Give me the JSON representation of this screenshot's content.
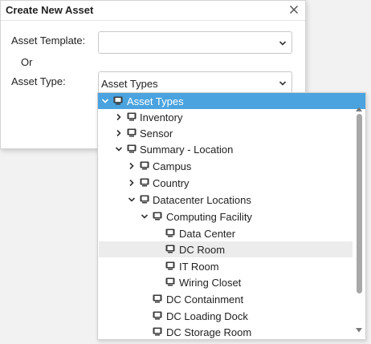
{
  "dialog": {
    "title": "Create New Asset",
    "asset_template_label": "Asset Template:",
    "asset_template_value": "",
    "or_label": "Or",
    "asset_type_label": "Asset Type:",
    "asset_type_value": "Asset Types"
  },
  "tree": {
    "items": [
      {
        "label": "Asset Types",
        "icon": "asset-node-icon",
        "toggle": "expanded"
      },
      {
        "label": "Inventory",
        "icon": "asset-node-icon",
        "toggle": "collapsed"
      },
      {
        "label": "Sensor",
        "icon": "asset-node-icon",
        "toggle": "collapsed"
      },
      {
        "label": "Summary - Location",
        "icon": "asset-node-icon",
        "toggle": "expanded"
      },
      {
        "label": "Campus",
        "icon": "asset-node-icon",
        "toggle": "collapsed"
      },
      {
        "label": "Country",
        "icon": "asset-node-icon",
        "toggle": "collapsed"
      },
      {
        "label": "Datacenter Locations",
        "icon": "asset-node-icon",
        "toggle": "expanded"
      },
      {
        "label": "Computing Facility",
        "icon": "asset-node-icon",
        "toggle": "expanded"
      },
      {
        "label": "Data Center",
        "icon": "asset-node-icon",
        "toggle": "none"
      },
      {
        "label": "DC Room",
        "icon": "asset-node-icon",
        "toggle": "none",
        "hovered": true
      },
      {
        "label": "IT Room",
        "icon": "asset-node-icon",
        "toggle": "none"
      },
      {
        "label": "Wiring Closet",
        "icon": "asset-node-icon",
        "toggle": "none"
      },
      {
        "label": "DC Containment",
        "icon": "asset-node-icon",
        "toggle": "none"
      },
      {
        "label": "DC Loading Dock",
        "icon": "asset-node-icon",
        "toggle": "none"
      },
      {
        "label": "DC Storage Room",
        "icon": "asset-node-icon",
        "toggle": "none"
      }
    ]
  },
  "colors": {
    "selected_row": "#4aa3df",
    "hover_row": "#ececec",
    "icon": "#3a3a3a"
  }
}
